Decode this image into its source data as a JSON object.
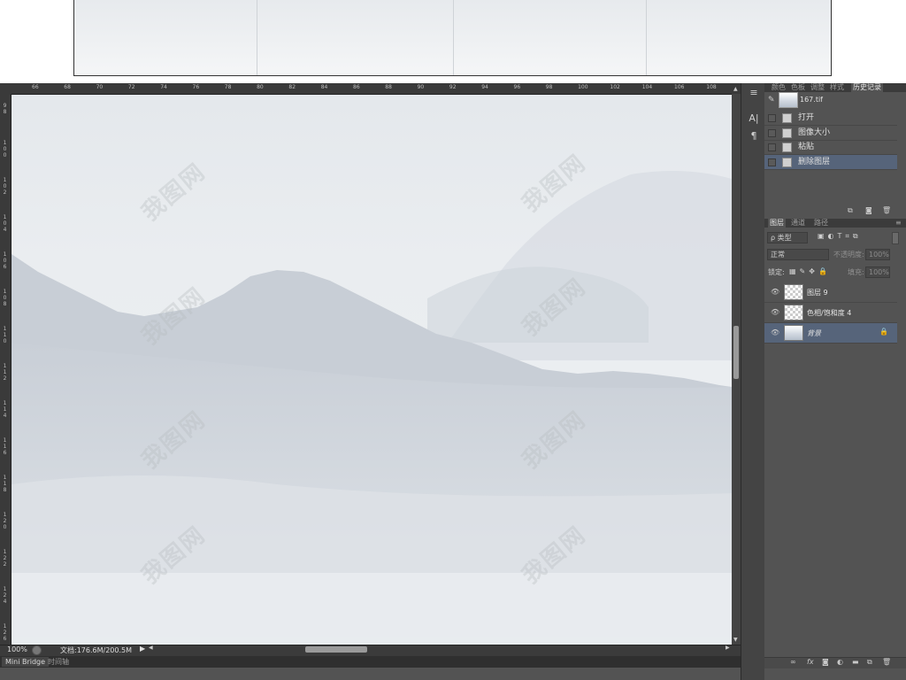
{
  "ruler": {
    "top_ticks": [
      "66",
      "68",
      "70",
      "72",
      "74",
      "76",
      "78",
      "80",
      "82",
      "84",
      "86",
      "88",
      "90",
      "92",
      "94",
      "96",
      "98",
      "100",
      "102",
      "104",
      "106",
      "108"
    ],
    "left_ticks": [
      "98",
      "100",
      "102",
      "104",
      "106",
      "108",
      "110",
      "112",
      "114",
      "116",
      "118",
      "120",
      "122",
      "124",
      "126"
    ]
  },
  "status": {
    "zoom": "100%",
    "doc_info": "文档:176.6M/200.5M"
  },
  "bottom_tabs": [
    "Mini Bridge",
    "时间轴"
  ],
  "history_panel": {
    "tabs": [
      "颜色",
      "色板",
      "调整",
      "样式",
      "历史记录"
    ],
    "snapshot_label": "167.tif",
    "items": [
      {
        "label": "打开",
        "selected": false
      },
      {
        "label": "图像大小",
        "selected": false
      },
      {
        "label": "粘贴",
        "selected": false
      },
      {
        "label": "删除图层",
        "selected": true
      }
    ]
  },
  "layers_panel": {
    "tabs": [
      "图层",
      "通道",
      "路径"
    ],
    "filter_kind": "ρ 类型",
    "blend_mode": "正常",
    "opacity_label": "不透明度:",
    "opacity_value": "100%",
    "lock_label": "锁定:",
    "fill_label": "填充:",
    "fill_value": "100%",
    "layers": [
      {
        "name": "图层 9",
        "selected": false
      },
      {
        "name": "色相/饱和度 4",
        "selected": false
      },
      {
        "name": "背景",
        "selected": true
      }
    ]
  },
  "watermark": "我图网",
  "colors": {
    "selected_row": "#56647a",
    "panel_bg": "#535353"
  }
}
